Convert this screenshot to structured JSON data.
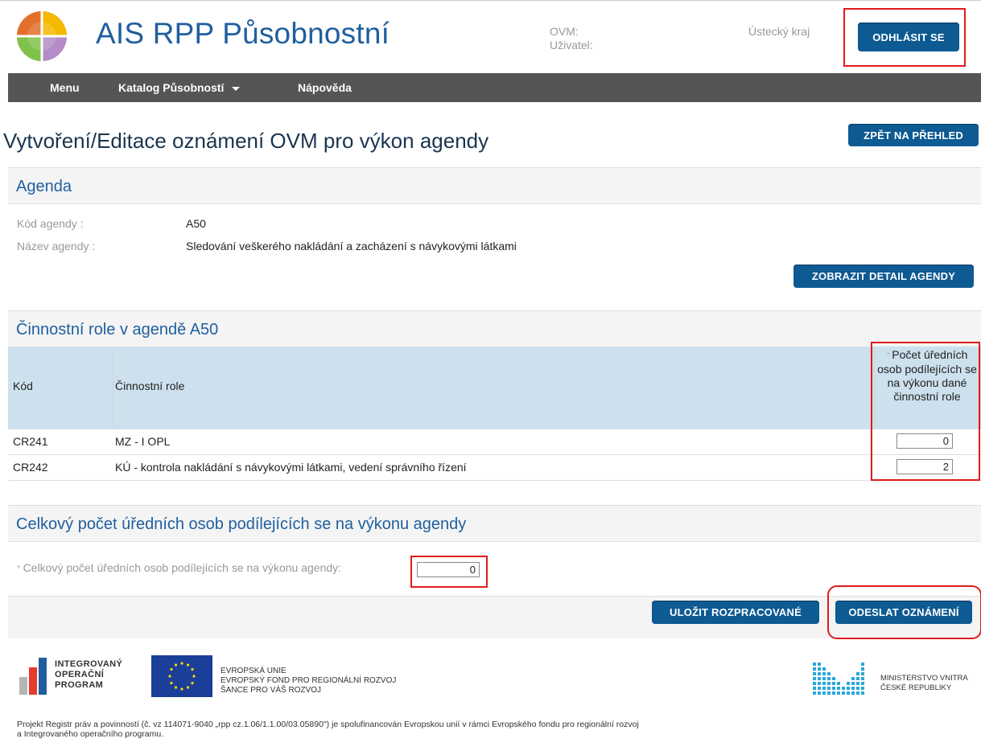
{
  "header": {
    "app_title": "AIS RPP Působnostní",
    "ovm_label": "OVM:",
    "user_label": "Uživatel:",
    "region": "Ústecký kraj",
    "logout_label": "ODHLÁSIT SE"
  },
  "nav": {
    "items": [
      {
        "label": "Menu"
      },
      {
        "label": "Katalog Působností"
      },
      {
        "label": "Nápověda"
      }
    ]
  },
  "page": {
    "title": "Vytvoření/Editace oznámení OVM pro výkon agendy",
    "back_label": "ZPĚT NA PŘEHLED"
  },
  "agenda": {
    "section_title": "Agenda",
    "code_label": "Kód agendy :",
    "code_value": "A50",
    "name_label": "Název agendy :",
    "name_value": "Sledování veškerého nakládání a zacházení s návykovými látkami",
    "detail_label": "ZOBRAZIT DETAIL AGENDY"
  },
  "roles": {
    "section_title": "Činnostní role v agendě A50",
    "col_code": "Kód",
    "col_role": "Činnostní role",
    "col_count": "Počet úředních osob podílejících se na výkonu dané činnostní role",
    "required_mark": "*",
    "rows": [
      {
        "code": "CR241",
        "role": "MZ - I OPL",
        "count": "0"
      },
      {
        "code": "CR242",
        "role": "KÚ - kontrola nakládání s návykovými látkami, vedení správního řízení",
        "count": "2"
      }
    ]
  },
  "total": {
    "section_title": "Celkový počet úředních osob podílejících se na výkonu agendy",
    "field_label": "Celkový počet úředních osob podílejících se na výkonu agendy:",
    "field_value": "0"
  },
  "actions": {
    "save_label": "ULOŽIT ROZPRACOVANÉ",
    "send_label": "ODESLAT OZNÁMENÍ"
  },
  "footer": {
    "iop_line1": "INTEGROVANÝ",
    "iop_line2": "OPERAČNÍ",
    "iop_line3": "PROGRAM",
    "eu_line1": "EVROPSKÁ UNIE",
    "eu_line2": "EVROPSKÝ FOND PRO REGIONÁLNÍ ROZVOJ",
    "eu_line3": "ŠANCE PRO VÁŠ ROZVOJ",
    "mv_line1": "MINISTERSTVO VNITRA",
    "mv_line2": "ČESKÉ REPUBLIKY",
    "note_line1": "Projekt Registr práv a povinností (č. vz 114071-9040 „rpp cz.1.06/1.1.00/03.05890\") je spolufinancován Evropskou unií v rámci Evropského fondu pro regionální rozvoj",
    "note_line2": "a Integrovaného operačního programu."
  },
  "colors": {
    "accent": "#0e5a93",
    "title_blue": "#1f5f9f",
    "nav_bg": "#555555",
    "table_head_bg": "#cde0ed",
    "highlight_red": "#e01b1b"
  }
}
